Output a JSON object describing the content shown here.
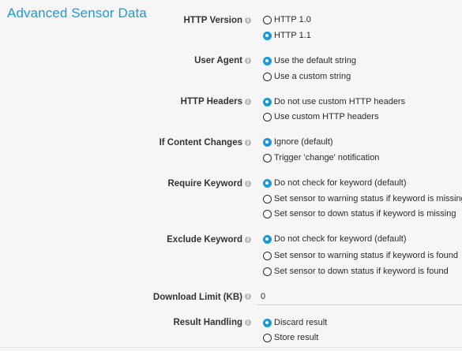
{
  "page": {
    "title": "Advanced Sensor Data"
  },
  "fields": [
    {
      "label": "HTTP Version",
      "options": [
        {
          "label": "HTTP 1.0",
          "selected": false
        },
        {
          "label": "HTTP 1.1",
          "selected": true
        }
      ]
    },
    {
      "label": "User Agent",
      "options": [
        {
          "label": "Use the default string",
          "selected": true
        },
        {
          "label": "Use a custom string",
          "selected": false
        }
      ]
    },
    {
      "label": "HTTP Headers",
      "options": [
        {
          "label": "Do not use custom HTTP headers",
          "selected": true
        },
        {
          "label": "Use custom HTTP headers",
          "selected": false
        }
      ]
    },
    {
      "label": "If Content Changes",
      "options": [
        {
          "label": "Ignore (default)",
          "selected": true
        },
        {
          "label": "Trigger 'change' notification",
          "selected": false
        }
      ]
    },
    {
      "label": "Require Keyword",
      "options": [
        {
          "label": "Do not check for keyword (default)",
          "selected": true
        },
        {
          "label": "Set sensor to warning status if keyword is missing",
          "selected": false
        },
        {
          "label": "Set sensor to down status if keyword is missing",
          "selected": false
        }
      ]
    },
    {
      "label": "Exclude Keyword",
      "options": [
        {
          "label": "Do not check for keyword (default)",
          "selected": true
        },
        {
          "label": "Set sensor to warning status if keyword is found",
          "selected": false
        },
        {
          "label": "Set sensor to down status if keyword is found",
          "selected": false
        }
      ]
    },
    {
      "label": "Download Limit (KB)",
      "value": "0"
    },
    {
      "label": "Result Handling",
      "options": [
        {
          "label": "Discard result",
          "selected": true
        },
        {
          "label": "Store result",
          "selected": false
        }
      ]
    }
  ],
  "icons": {
    "info": "info-icon",
    "info_glyph": "i"
  },
  "colors": {
    "accent": "#1a9bd7",
    "background": "#f6f6f6",
    "text": "#2b2b2b"
  }
}
